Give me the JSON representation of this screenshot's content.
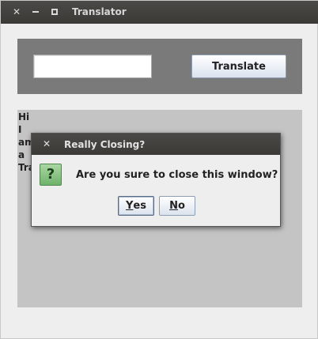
{
  "window": {
    "title": "Translator",
    "controls": {
      "close": "✕",
      "minimize": "minimize",
      "maximize": "maximize"
    }
  },
  "toolbar": {
    "input_value": "",
    "translate_label": "Translate"
  },
  "output": {
    "lines": [
      "Hi",
      "I",
      "am",
      "a",
      "Tra"
    ]
  },
  "dialog": {
    "title": "Really Closing?",
    "close_glyph": "✕",
    "icon_glyph": "?",
    "message": "Are you sure to close this window?",
    "yes_mnemonic": "Y",
    "yes_rest": "es",
    "no_mnemonic": "N",
    "no_rest": "o"
  }
}
